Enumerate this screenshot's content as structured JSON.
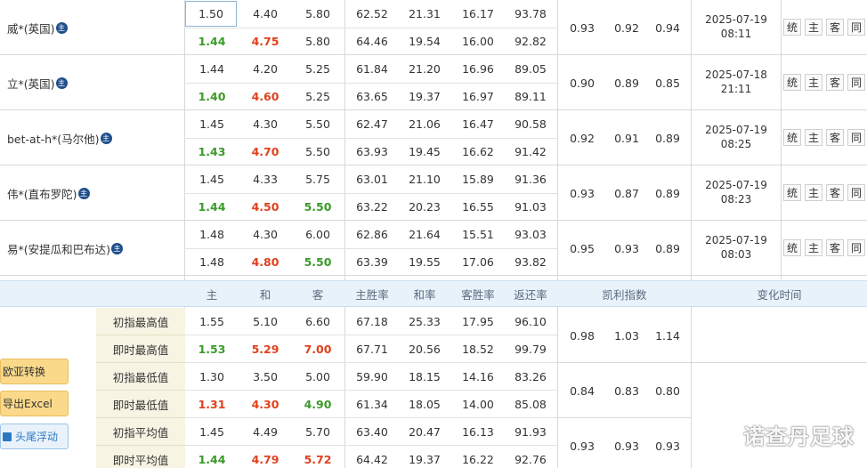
{
  "bookmakers": [
    {
      "name": "威*(英国)",
      "icon": "主",
      "time_date": "2025-07-19",
      "time_clock": "08:11",
      "initial": {
        "home": "1.50",
        "draw": "4.40",
        "away": "5.80",
        "home_rate": "62.52",
        "draw_rate": "21.31",
        "away_rate": "16.17",
        "return_rate": "93.78"
      },
      "live": {
        "home": "1.44",
        "draw": "4.75",
        "away": "5.80",
        "home_rate": "64.46",
        "draw_rate": "19.54",
        "away_rate": "16.00",
        "return_rate": "92.82"
      },
      "kelly": [
        "0.93",
        "0.92",
        "0.94"
      ]
    },
    {
      "name": "立*(英国)",
      "icon": "主",
      "time_date": "2025-07-18",
      "time_clock": "21:11",
      "initial": {
        "home": "1.44",
        "draw": "4.20",
        "away": "5.25",
        "home_rate": "61.84",
        "draw_rate": "21.20",
        "away_rate": "16.96",
        "return_rate": "89.05"
      },
      "live": {
        "home": "1.40",
        "draw": "4.60",
        "away": "5.25",
        "home_rate": "63.65",
        "draw_rate": "19.37",
        "away_rate": "16.97",
        "return_rate": "89.11"
      },
      "kelly": [
        "0.90",
        "0.89",
        "0.85"
      ]
    },
    {
      "name": "bet-at-h*(马尔他)",
      "icon": "主",
      "time_date": "2025-07-19",
      "time_clock": "08:25",
      "initial": {
        "home": "1.45",
        "draw": "4.30",
        "away": "5.50",
        "home_rate": "62.47",
        "draw_rate": "21.06",
        "away_rate": "16.47",
        "return_rate": "90.58"
      },
      "live": {
        "home": "1.43",
        "draw": "4.70",
        "away": "5.50",
        "home_rate": "63.93",
        "draw_rate": "19.45",
        "away_rate": "16.62",
        "return_rate": "91.42"
      },
      "kelly": [
        "0.92",
        "0.91",
        "0.89"
      ]
    },
    {
      "name": "伟*(直布罗陀)",
      "icon": "主",
      "time_date": "2025-07-19",
      "time_clock": "08:23",
      "initial": {
        "home": "1.45",
        "draw": "4.33",
        "away": "5.75",
        "home_rate": "63.01",
        "draw_rate": "21.10",
        "away_rate": "15.89",
        "return_rate": "91.36"
      },
      "live": {
        "home": "1.44",
        "draw": "4.50",
        "away": "5.50",
        "home_rate": "63.22",
        "draw_rate": "20.23",
        "away_rate": "16.55",
        "return_rate": "91.03"
      },
      "kelly": [
        "0.93",
        "0.87",
        "0.89"
      ]
    },
    {
      "name": "易*(安提瓜和巴布达)",
      "icon": "主",
      "time_date": "2025-07-19",
      "time_clock": "08:03",
      "initial": {
        "home": "1.48",
        "draw": "4.30",
        "away": "6.00",
        "home_rate": "62.86",
        "draw_rate": "21.64",
        "away_rate": "15.51",
        "return_rate": "93.03"
      },
      "live": {
        "home": "1.48",
        "draw": "4.80",
        "away": "5.50",
        "home_rate": "63.39",
        "draw_rate": "19.55",
        "away_rate": "17.06",
        "return_rate": "93.82"
      },
      "kelly": [
        "0.95",
        "0.93",
        "0.89"
      ]
    }
  ],
  "row_buttons": [
    "统",
    "主",
    "客",
    "同"
  ],
  "header": {
    "home": "主",
    "draw": "和",
    "away": "客",
    "home_rate": "主胜率",
    "draw_rate": "和率",
    "away_rate": "客胜率",
    "return_rate": "返还率",
    "kelly": "凯利指数",
    "change_time": "变化时间"
  },
  "stats": [
    {
      "label": "初指最高值",
      "home": "1.55",
      "draw": "5.10",
      "away": "6.60",
      "home_rate": "67.18",
      "draw_rate": "25.33",
      "away_rate": "17.95",
      "return_rate": "96.10"
    },
    {
      "label": "即时最高值",
      "home": "1.53",
      "draw": "5.29",
      "away": "7.00",
      "home_rate": "67.71",
      "draw_rate": "20.56",
      "away_rate": "18.52",
      "return_rate": "99.79"
    },
    {
      "label": "初指最低值",
      "home": "1.30",
      "draw": "3.50",
      "away": "5.00",
      "home_rate": "59.90",
      "draw_rate": "18.15",
      "away_rate": "14.16",
      "return_rate": "83.26"
    },
    {
      "label": "即时最低值",
      "home": "1.31",
      "draw": "4.30",
      "away": "4.90",
      "home_rate": "61.34",
      "draw_rate": "18.05",
      "away_rate": "14.00",
      "return_rate": "85.08"
    },
    {
      "label": "初指平均值",
      "home": "1.45",
      "draw": "4.49",
      "away": "5.70",
      "home_rate": "63.40",
      "draw_rate": "20.47",
      "away_rate": "16.13",
      "return_rate": "91.93"
    },
    {
      "label": "即时平均值",
      "home": "1.44",
      "draw": "4.79",
      "away": "5.72",
      "home_rate": "64.42",
      "draw_rate": "19.37",
      "away_rate": "16.22",
      "return_rate": "92.76"
    }
  ],
  "stats_kelly": [
    [
      "0.98",
      "1.03",
      "1.14"
    ],
    [
      "0.84",
      "0.83",
      "0.80"
    ],
    [
      "0.93",
      "0.93",
      "0.93"
    ]
  ],
  "side_buttons": [
    "欧亚转换",
    "导出Excel",
    "头尾浮动"
  ],
  "watermark": "诺查丹足球",
  "colors": {
    "up": "#e0411c",
    "down": "#3b9a2a",
    "header_bg": "#e8f2fb",
    "label_bg": "#f7f4e4",
    "button_bg": "#fbd98a"
  }
}
